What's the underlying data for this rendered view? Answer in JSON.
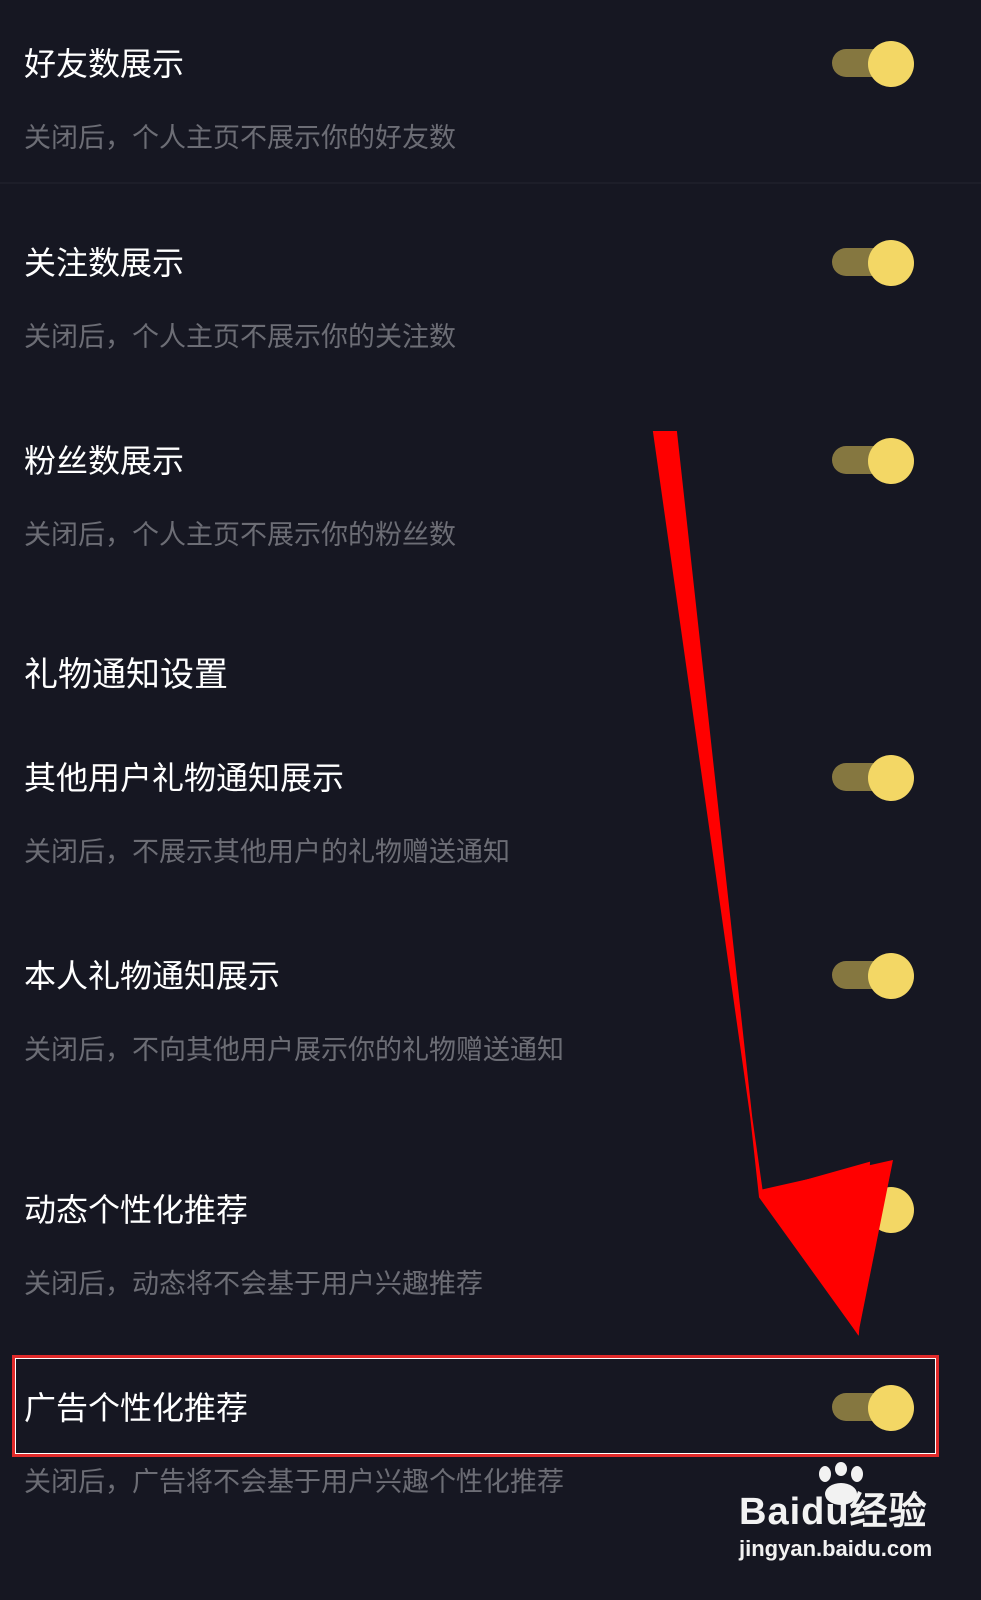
{
  "settings": [
    {
      "title": "好友数展示",
      "desc": "关闭后，个人主页不展示你的好友数",
      "enabled": true
    },
    {
      "title": "关注数展示",
      "desc": "关闭后，个人主页不展示你的关注数",
      "enabled": true
    },
    {
      "title": "粉丝数展示",
      "desc": "关闭后，个人主页不展示你的粉丝数",
      "enabled": true
    }
  ],
  "gift_section": {
    "title": "礼物通知设置",
    "items": [
      {
        "title": "其他用户礼物通知展示",
        "desc": "关闭后，不展示其他用户的礼物赠送通知",
        "enabled": true
      },
      {
        "title": "本人礼物通知展示",
        "desc": "关闭后，不向其他用户展示你的礼物赠送通知",
        "enabled": true
      }
    ]
  },
  "recommend": [
    {
      "title": "动态个性化推荐",
      "desc": "关闭后，动态将不会基于用户兴趣推荐",
      "enabled": true
    },
    {
      "title": "广告个性化推荐",
      "desc": "关闭后，广告将不会基于用户兴趣个性化推荐",
      "enabled": true
    }
  ],
  "colors": {
    "background": "#161722",
    "toggle_track": "#857740",
    "toggle_knob": "#f3d765",
    "annotation": "#ff0000"
  },
  "watermark": {
    "logo": "Baidu经验",
    "url": "jingyan.baidu.com"
  }
}
